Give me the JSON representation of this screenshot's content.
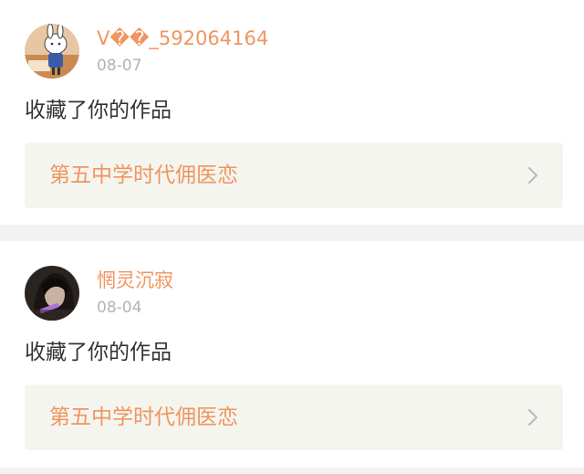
{
  "notifications": [
    {
      "username": "V��_592064164",
      "date": "08-07",
      "action": "收藏了你的作品",
      "work_title": "第五中学时代佣医恋",
      "avatar_icon": "cartoon-bunny-avatar"
    },
    {
      "username": "惘灵沉寂",
      "date": "08-04",
      "action": "收藏了你的作品",
      "work_title": "第五中学时代佣医恋",
      "avatar_icon": "dark-anime-avatar"
    }
  ],
  "colors": {
    "accent": "#f0955f",
    "date": "#b3b3b3",
    "text": "#333333",
    "link_bg": "#f5f5ef",
    "page_bg": "#f2f2f2"
  }
}
